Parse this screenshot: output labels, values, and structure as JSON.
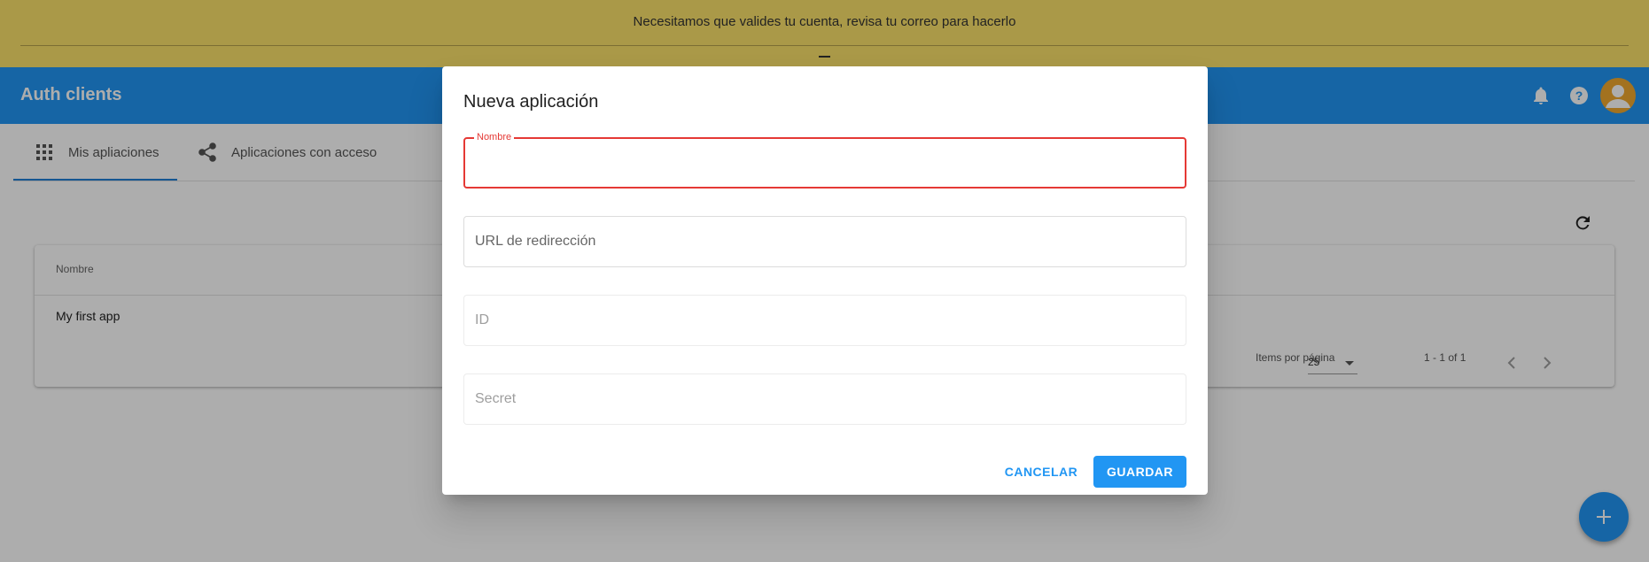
{
  "banner": {
    "message": "Necesitamos que valides tu cuenta, revisa tu correo para hacerlo"
  },
  "app": {
    "title": "Auth clients",
    "colors": {
      "primary": "#2196f3",
      "banner": "#fbe26a",
      "error": "#e53935",
      "avatar": "#f0a82f"
    },
    "icons": [
      "bell-icon",
      "help-icon",
      "account-avatar-icon"
    ]
  },
  "tabs": [
    {
      "label": "Mis apliaciones",
      "icon": "apps-grid-icon",
      "active": true
    },
    {
      "label": "Aplicaciones con acceso",
      "icon": "share-icon",
      "active": false
    }
  ],
  "table": {
    "column_name": "Nombre",
    "rows": [
      {
        "name": "My first app"
      }
    ],
    "paginator": {
      "items_per_page_label": "Items por página",
      "page_size": "25",
      "range": "1 - 1 of 1"
    }
  },
  "dialog": {
    "title": "Nueva aplicación",
    "fields": {
      "name": {
        "label": "Nombre",
        "value": ""
      },
      "redirect_url": {
        "placeholder": "URL de redirección",
        "value": ""
      },
      "id": {
        "placeholder": "ID",
        "value": ""
      },
      "secret": {
        "placeholder": "Secret",
        "value": ""
      }
    },
    "cancel_label": "CANCELAR",
    "save_label": "GUARDAR"
  }
}
